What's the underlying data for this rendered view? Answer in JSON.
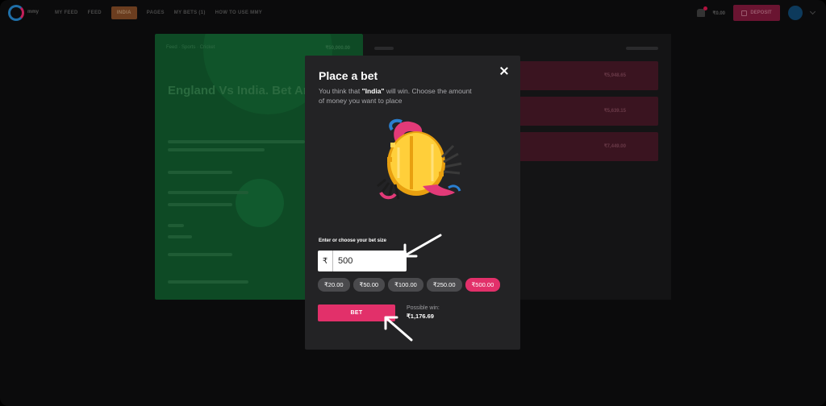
{
  "nav": {
    "logo_text": "mmy",
    "links": [
      "MY FEED",
      "FEED",
      "INDIA",
      "PAGES",
      "MY BETS (1)",
      "HOW TO USE MMY"
    ],
    "balance": "₹0.00",
    "deposit_label": "DEPOSIT"
  },
  "background": {
    "breadcrumb": "Feed  ·  Sports  ·  Cricket",
    "prize": "₹50,000.00",
    "title": "England Vs India. Bet Am",
    "amounts": [
      "₹5,948.65",
      "₹5,639.15",
      "₹7,449.00"
    ]
  },
  "modal": {
    "title": "Place a bet",
    "desc_prefix": "You think that ",
    "team": "\"India\"",
    "desc_suffix": " will win. Choose the amount of money you want to place",
    "bet_label": "Enter or choose your bet size",
    "currency": "₹",
    "bet_value": "500",
    "chips": [
      "₹20.00",
      "₹50.00",
      "₹100.00",
      "₹250.00",
      "₹500.00"
    ],
    "selected_chip": 4,
    "bet_button": "BET",
    "possible_win_label": "Possible win:",
    "possible_win_value": "₹1,176.69"
  },
  "colors": {
    "accent": "#e2306a",
    "modal_bg": "#232325",
    "overlay_bg": "#0b0b0c"
  }
}
